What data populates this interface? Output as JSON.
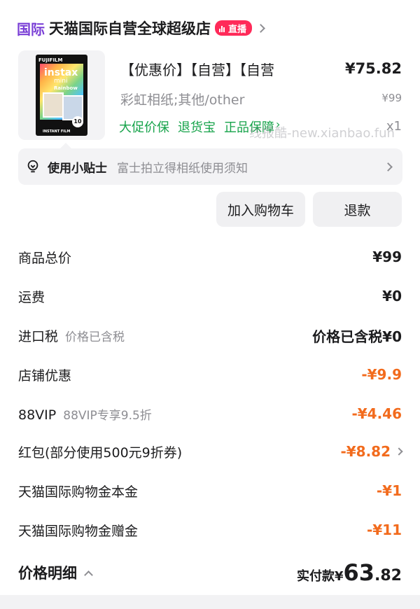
{
  "shop": {
    "tag": "国际",
    "name": "天猫国际自营全球超级店",
    "live_badge": "直播"
  },
  "product": {
    "title": "【优惠价】【自营】【自营",
    "price": "¥75.82",
    "spec": "彩虹相纸;其他/other",
    "original_price": "¥99",
    "services": [
      "大促价保",
      "退货宝",
      "正品保障"
    ],
    "services_chevron": "›",
    "quantity": "x1",
    "image": {
      "brand": "FUJIFILM",
      "line1": "instax",
      "line2": "mini",
      "line3": "Rainbow",
      "count": "10",
      "label": "INSTANT FILM"
    }
  },
  "watermark": "线报酷-new.xianbao.fun",
  "tip": {
    "title": "使用小贴士",
    "text": "富士拍立得相纸使用须知"
  },
  "actions": {
    "add_to_cart": "加入购物车",
    "refund": "退款"
  },
  "price_lines": [
    {
      "label": "商品总价",
      "sub": "",
      "value": "¥99"
    },
    {
      "label": "运费",
      "sub": "",
      "value": "¥0"
    },
    {
      "label": "进口税",
      "sub": "价格已含税",
      "value": "价格已含税¥0"
    },
    {
      "label": "店铺优惠",
      "sub": "",
      "value": "-¥9.9"
    },
    {
      "label": "88VIP",
      "sub": "88VIP专享9.5折",
      "value": "-¥4.46"
    },
    {
      "label": "红包(部分使用500元9折券)",
      "sub": "",
      "value": "-¥8.82"
    },
    {
      "label": "天猫国际购物金本金",
      "sub": "",
      "value": "-¥1"
    },
    {
      "label": "天猫国际购物金赠金",
      "sub": "",
      "value": "-¥11"
    }
  ],
  "total": {
    "label": "价格明细",
    "prefix": "实付款¥",
    "integer": "63",
    "decimal": ".82"
  },
  "colors": {
    "tag_purple": "#7a3fd6",
    "live_red": "#ff2a59",
    "service_green": "#16a34a",
    "discount_orange": "#f26b1d"
  }
}
